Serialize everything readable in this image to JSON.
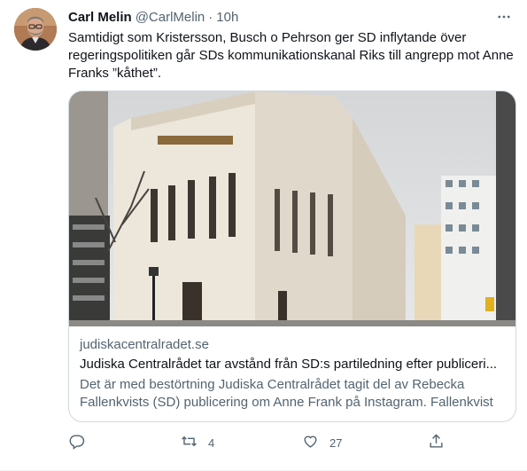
{
  "tweet": {
    "author_name": "Carl Melin",
    "handle": "@CarlMelin",
    "separator": "·",
    "time": "10h",
    "text": "Samtidigt som Kristersson, Busch o Pehrson ger SD inflytande över regeringspolitiken går SDs kommunikationskanal Riks till angrepp mot Anne Franks ”kåthet”."
  },
  "card": {
    "domain": "judiskacentralradet.se",
    "title": "Judiska Centralrådet tar avstånd från SD:s partiledning efter publiceri...",
    "description": "Det är med bestörtning Judiska Centralrådet tagit del av Rebecka Fallenkvists (SD) publicering om Anne Frank på Instagram. Fallenkvist ..."
  },
  "actions": {
    "reply_count": "",
    "retweet_count": "4",
    "like_count": "27"
  },
  "icons": {
    "more": "more-icon",
    "reply": "reply-icon",
    "retweet": "retweet-icon",
    "like": "heart-icon",
    "share": "share-icon"
  },
  "colors": {
    "secondary_text": "#536471",
    "border": "#cfd9de",
    "primary_text": "#0f1419"
  }
}
